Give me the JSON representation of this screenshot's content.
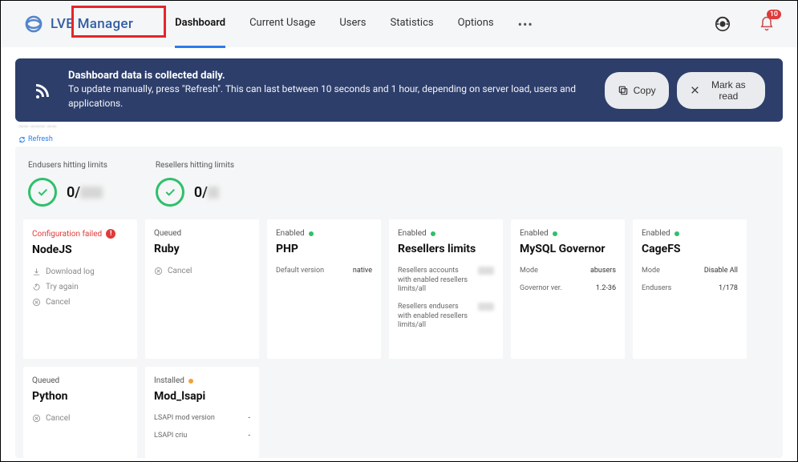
{
  "brand": "LVE Manager",
  "nav": {
    "items": [
      "Dashboard",
      "Current Usage",
      "Users",
      "Statistics",
      "Options"
    ],
    "more": "•••",
    "notifications": "10"
  },
  "banner": {
    "title": "Dashboard data is collected daily.",
    "text": "To update manually, press \"Refresh\". This can last between 10 seconds and 1 hour, depending on server load, users and applications.",
    "copy": "Copy",
    "mark": "Mark as read"
  },
  "refresh": "Refresh",
  "limits": {
    "endusers_label": "Endusers hitting limits",
    "endusers_value": "0/",
    "resellers_label": "Resellers hitting limits",
    "resellers_value": "0/"
  },
  "cards": {
    "nodejs": {
      "status": "Configuration failed",
      "title": "NodeJS",
      "download": "Download log",
      "try": "Try again",
      "cancel": "Cancel"
    },
    "ruby": {
      "status": "Queued",
      "title": "Ruby",
      "cancel": "Cancel"
    },
    "php": {
      "status": "Enabled",
      "title": "PHP",
      "defver_label": "Default version",
      "defver_value": "native"
    },
    "resellers": {
      "status": "Enabled",
      "title": "Resellers limits",
      "row1": "Resellers accounts with enabled resellers limits/all",
      "row2": "Resellers endusers with enabled resellers limits/all"
    },
    "mysql": {
      "status": "Enabled",
      "title": "MySQL Governor",
      "mode_label": "Mode",
      "mode_value": "abusers",
      "ver_label": "Governor ver.",
      "ver_value": "1.2-36"
    },
    "cagefs": {
      "status": "Enabled",
      "title": "CageFS",
      "mode_label": "Mode",
      "mode_value": "Disable All",
      "end_label": "Endusers",
      "end_value": "1/178"
    },
    "python": {
      "status": "Queued",
      "title": "Python",
      "cancel": "Cancel"
    },
    "modlsapi": {
      "status": "Installed",
      "title": "Mod_lsapi",
      "row1": "LSAPI mod version",
      "row1v": "-",
      "row2": "LSAPI criu",
      "row2v": "-"
    }
  }
}
